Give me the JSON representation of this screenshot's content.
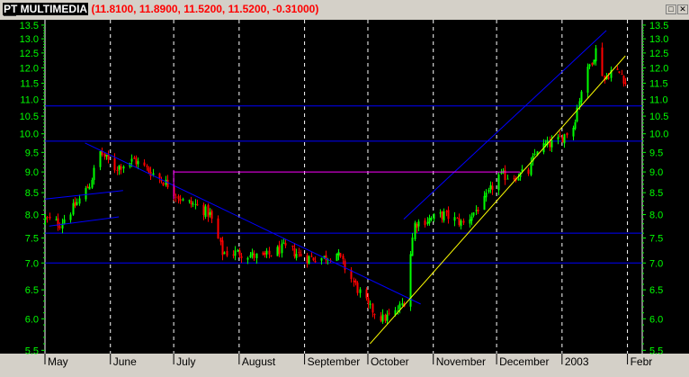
{
  "window": {
    "symbol": "PT MULTIMEDIA",
    "values": "(11.8100, 11.8900, 11.5200, 11.5200, -0.31000)"
  },
  "colors": {
    "up_candle": "#00ff00",
    "down_candle": "#ff0000",
    "axis_text": "#00ff00",
    "month_text": "#000000",
    "horizontal_line": "#0000ff",
    "trend_line_blue": "#0000ff",
    "trend_line_yellow": "#ffff00",
    "trend_line_magenta": "#ff00ff",
    "background": "#000000"
  },
  "chart_data": {
    "type": "candlestick",
    "y_scale": "log",
    "ylim": [
      5.45,
      13.7
    ],
    "y_ticks": [
      "5.5",
      "6.0",
      "6.5",
      "7.0",
      "7.5",
      "8.0",
      "8.5",
      "9.0",
      "9.5",
      "10.0",
      "10.5",
      "11.0",
      "11.5",
      "12.0",
      "12.5",
      "13.0",
      "13.5"
    ],
    "x_months": [
      "May",
      "June",
      "July",
      "August",
      "September",
      "October",
      "November",
      "December",
      "2003",
      "Febr"
    ],
    "month_boundaries": [
      "2002-05-01",
      "2002-06-01",
      "2002-07-01",
      "2002-08-01",
      "2002-09-01",
      "2002-10-01",
      "2002-11-01",
      "2002-12-01",
      "2003-01-01",
      "2003-02-01"
    ],
    "x_start": "2002-05-01",
    "x_end": "2003-02-08",
    "close_anchors": [
      [
        "2002-05-01",
        7.9
      ],
      [
        "2002-05-08",
        7.8
      ],
      [
        "2002-05-15",
        8.2
      ],
      [
        "2002-05-22",
        8.7
      ],
      [
        "2002-05-27",
        9.5
      ],
      [
        "2002-06-03",
        9.1
      ],
      [
        "2002-06-12",
        9.3
      ],
      [
        "2002-06-20",
        9.0
      ],
      [
        "2002-06-28",
        8.7
      ],
      [
        "2002-07-05",
        8.3
      ],
      [
        "2002-07-12",
        8.2
      ],
      [
        "2002-07-18",
        8.0
      ],
      [
        "2002-07-24",
        7.2
      ],
      [
        "2002-08-01",
        7.2
      ],
      [
        "2002-08-12",
        7.1
      ],
      [
        "2002-08-22",
        7.3
      ],
      [
        "2002-09-02",
        7.1
      ],
      [
        "2002-09-10",
        7.1
      ],
      [
        "2002-09-16",
        7.2
      ],
      [
        "2002-09-23",
        6.7
      ],
      [
        "2002-10-01",
        6.2
      ],
      [
        "2002-10-08",
        6.0
      ],
      [
        "2002-10-14",
        6.1
      ],
      [
        "2002-10-18",
        6.3
      ],
      [
        "2002-10-23",
        7.8
      ],
      [
        "2002-10-30",
        7.9
      ],
      [
        "2002-11-06",
        8.0
      ],
      [
        "2002-11-15",
        7.8
      ],
      [
        "2002-11-25",
        8.3
      ],
      [
        "2002-12-02",
        8.9
      ],
      [
        "2002-12-10",
        8.9
      ],
      [
        "2002-12-16",
        9.0
      ],
      [
        "2002-12-20",
        9.6
      ],
      [
        "2002-12-30",
        9.8
      ],
      [
        "2003-01-06",
        10.2
      ],
      [
        "2003-01-10",
        11.3
      ],
      [
        "2003-01-14",
        12.1
      ],
      [
        "2003-01-17",
        12.6
      ],
      [
        "2003-01-21",
        11.6
      ],
      [
        "2003-01-24",
        11.9
      ],
      [
        "2003-01-29",
        11.8
      ],
      [
        "2003-01-31",
        11.52
      ]
    ],
    "horizontal_levels": [
      10.8,
      9.8,
      7.6,
      7.0
    ],
    "trend_lines": [
      {
        "color": "#0000ff",
        "from": [
          "2002-05-01",
          8.35
        ],
        "to": [
          "2002-06-07",
          8.55
        ]
      },
      {
        "color": "#0000ff",
        "from": [
          "2002-05-03",
          7.75
        ],
        "to": [
          "2002-06-05",
          7.95
        ]
      },
      {
        "color": "#0000ff",
        "from": [
          "2002-05-20",
          9.75
        ],
        "to": [
          "2002-10-26",
          6.25
        ]
      },
      {
        "color": "#0000ff",
        "from": [
          "2002-10-18",
          7.9
        ],
        "to": [
          "2003-01-22",
          13.3
        ]
      },
      {
        "color": "#ffff00",
        "from": [
          "2002-10-02",
          5.6
        ],
        "to": [
          "2003-01-31",
          12.4
        ]
      },
      {
        "color": "#ff00ff",
        "from": [
          "2002-07-01",
          9.05
        ],
        "to": [
          "2002-07-01",
          8.35
        ]
      },
      {
        "color": "#ff00ff",
        "from": [
          "2002-07-01",
          9.0
        ],
        "to": [
          "2002-12-12",
          9.0
        ]
      }
    ]
  }
}
